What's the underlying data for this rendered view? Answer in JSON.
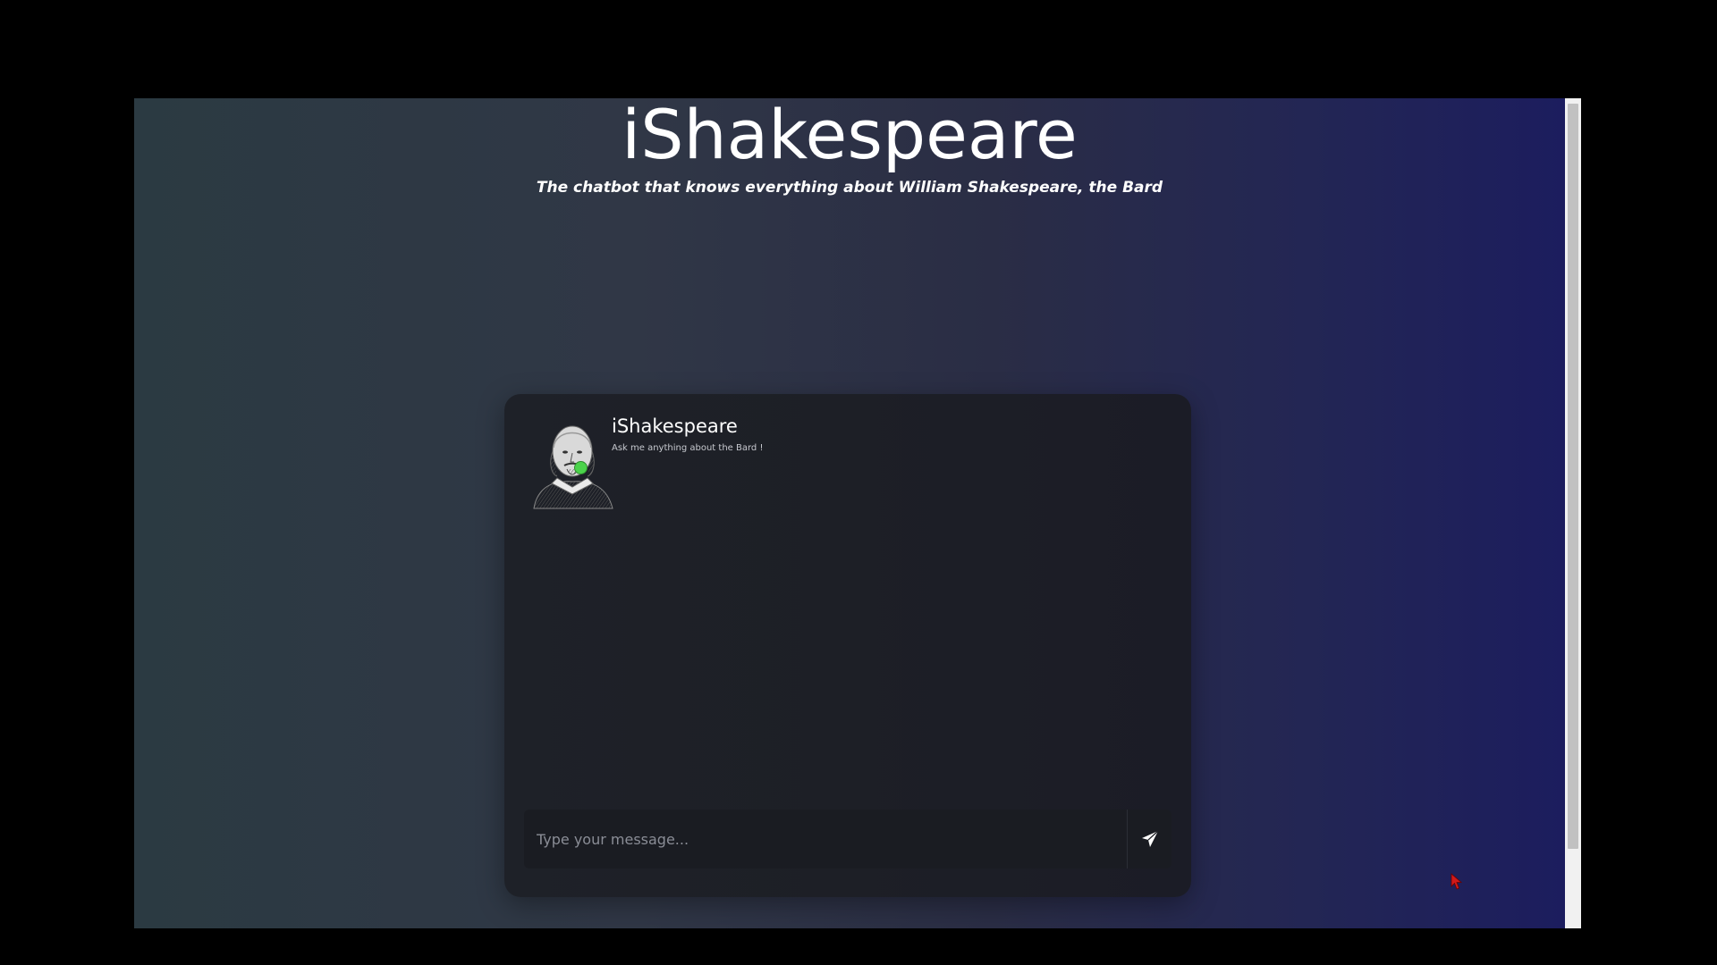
{
  "header": {
    "title": "iShakespeare",
    "subtitle": "The chatbot that knows everything about William Shakespeare, the Bard"
  },
  "chat": {
    "bot_name": "iShakespeare",
    "bot_tagline": "Ask me anything about the Bard !",
    "status": "online",
    "status_color": "#4bd34b",
    "messages": [],
    "input": {
      "placeholder": "Type your message...",
      "value": ""
    },
    "send_icon": "paper-plane-icon"
  },
  "colors": {
    "page_gradient_start": "#2b3a42",
    "page_gradient_end": "#1c1d5e",
    "card_background": "#1e2128"
  }
}
